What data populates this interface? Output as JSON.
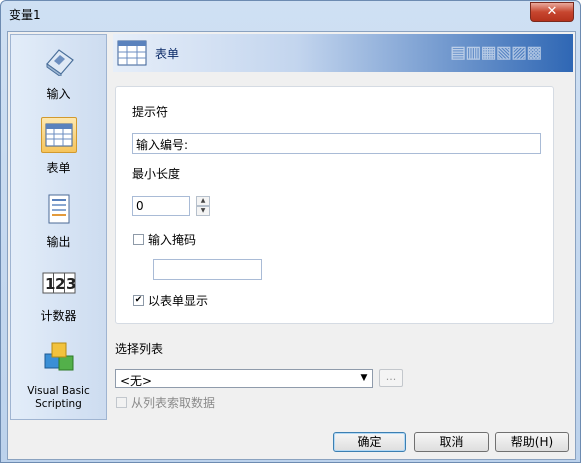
{
  "window": {
    "title": "变量1",
    "close_label": "✕"
  },
  "sidebar": {
    "items": [
      {
        "label": "输入",
        "icon": "keyboard-icon"
      },
      {
        "label": "表单",
        "icon": "form-grid-icon",
        "selected": true
      },
      {
        "label": "输出",
        "icon": "document-icon"
      },
      {
        "label": "计数器",
        "icon": "counter-123-icon"
      },
      {
        "label": "Visual Basic Scripting",
        "icon": "blocks-icon"
      }
    ]
  },
  "header": {
    "title": "表单"
  },
  "form": {
    "prompt_label": "提示符",
    "prompt_value": "输入编号:",
    "min_length_label": "最小长度",
    "min_length_value": "0",
    "mask_label": "输入掩码",
    "mask_checked": false,
    "mask_value": "",
    "show_form_label": "以表单显示",
    "show_form_checked": true
  },
  "list": {
    "label": "选择列表",
    "selected": "<无>",
    "ellipsis": "...",
    "from_list_label": "从列表索取数据",
    "from_list_checked": false
  },
  "buttons": {
    "ok": "确定",
    "cancel": "取消",
    "help": "帮助(H)"
  }
}
